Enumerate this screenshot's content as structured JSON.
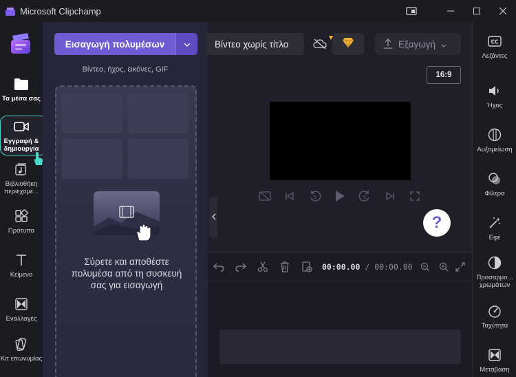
{
  "window": {
    "title": "Microsoft Clipchamp",
    "controls": [
      "cast-icon",
      "minimize-icon",
      "maximize-icon",
      "close-icon"
    ]
  },
  "left_rail": {
    "items": [
      {
        "label": "Τα μέσα σας",
        "icon": "folder-icon"
      },
      {
        "label": "Εγγραφή & δημιουργία",
        "icon": "camera-icon"
      },
      {
        "label": "Βιβλιοθήκη περιεχομέ...",
        "icon": "library-icon"
      },
      {
        "label": "Πρότυπα",
        "icon": "templates-icon"
      },
      {
        "label": "Κείμενο",
        "icon": "text-icon"
      },
      {
        "label": "Εναλλαγές",
        "icon": "transitions-icon"
      },
      {
        "label": "Κιτ επωνυμίας",
        "icon": "brand-kit-icon"
      }
    ]
  },
  "media_panel": {
    "import_label": "Εισαγωγή πολυμέσων",
    "subtitle": "Βίντεο, ήχος, εικόνες, GIF",
    "drop_text": "Σύρετε και αποθέστε πολυμέσα από τη συσκευή σας για εισαγωγή"
  },
  "header": {
    "project_title": "Βίντεο χωρίς τίτλο",
    "export_label": "Εξαγωγή",
    "aspect_ratio": "16:9"
  },
  "player": {
    "help_label": "?"
  },
  "timeline": {
    "current_time": "00:00.00",
    "separator": "/",
    "total_time": "00:00.00"
  },
  "right_rail": {
    "items": [
      {
        "label": "Λεζάντες",
        "icon": "captions-icon"
      },
      {
        "label": "Ήχος",
        "icon": "audio-icon"
      },
      {
        "label": "Αυξομείωση",
        "icon": "fade-icon"
      },
      {
        "label": "Φίλτρα",
        "icon": "filters-icon"
      },
      {
        "label": "Εφέ",
        "icon": "effects-icon"
      },
      {
        "label": "Προσαρμο... χρωμάτων",
        "icon": "color-adjust-icon"
      },
      {
        "label": "Ταχύτητα",
        "icon": "speed-icon"
      },
      {
        "label": "Μετάβαση",
        "icon": "transition-icon"
      }
    ]
  },
  "colors": {
    "accent": "#6f5bd3",
    "focus_ring": "#49d7c7",
    "premium": "#f4b43a"
  }
}
